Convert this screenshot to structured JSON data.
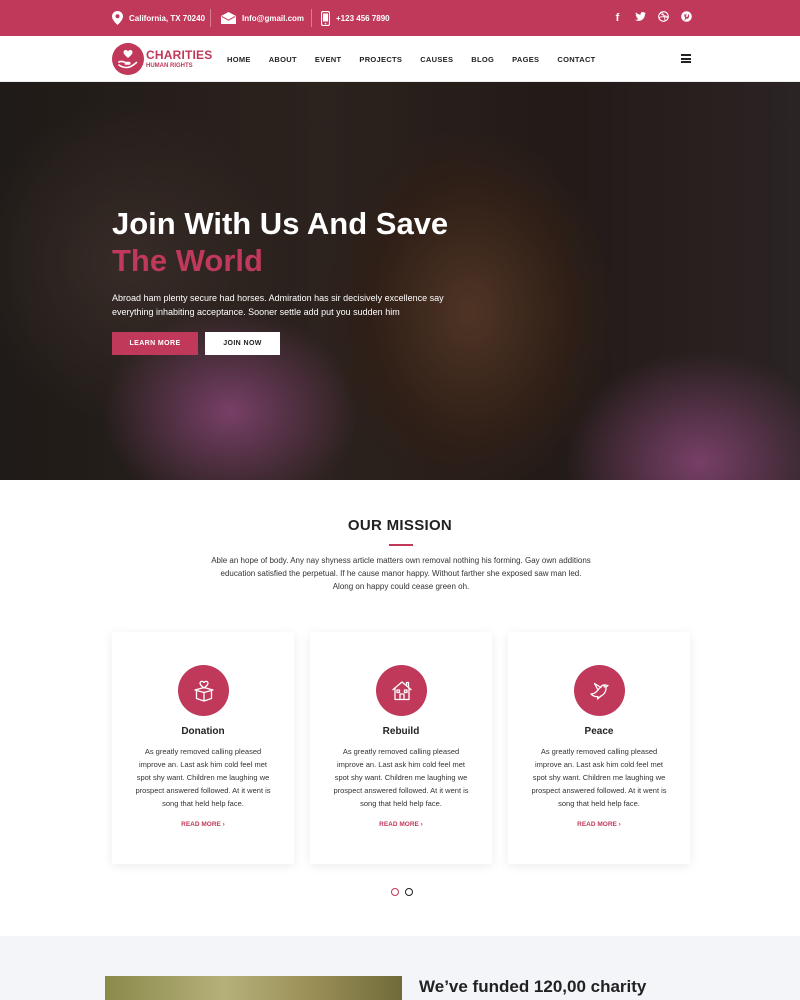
{
  "topbar": {
    "address": "California, TX 70240",
    "email": "Info@gmail.com",
    "phone": "+123 456 7890",
    "socials": [
      "facebook-icon",
      "twitter-icon",
      "dribbble-icon",
      "pinterest-icon"
    ]
  },
  "logo": {
    "title": "CHARITIES",
    "subtitle": "HUMAN RIGHTS"
  },
  "nav": {
    "items": [
      "HOME",
      "ABOUT",
      "EVENT",
      "PROJECTS",
      "CAUSES",
      "BLOG",
      "PAGES",
      "CONTACT"
    ]
  },
  "hero": {
    "title_line1": "Join With Us And Save",
    "title_line2": "The World",
    "text": "Abroad ham plenty secure had horses. Admiration has sir decisively excellence say everything inhabiting acceptance. Sooner settle add put you sudden him",
    "btn_primary": "LEARN MORE",
    "btn_secondary": "JOIN NOW"
  },
  "mission": {
    "title": "OUR MISSION",
    "text": "Able an hope of body. Any nay shyness article matters own removal nothing his forming. Gay own additions education satisfied the perpetual. If he cause manor happy. Without farther she exposed saw man led. Along on happy could cease green oh.",
    "cards": [
      {
        "title": "Donation",
        "icon": "gift-box-heart-icon",
        "text": "As greatly removed calling pleased improve an. Last ask him cold feel met spot shy want. Children me laughing we prospect answered followed. At it went is song that held help face.",
        "link": "READ MORE ›"
      },
      {
        "title": "Rebuild",
        "icon": "house-icon",
        "text": "As greatly removed calling pleased improve an. Last ask him cold feel met spot shy want. Children me laughing we prospect answered followed. At it went is song that held help face.",
        "link": "READ MORE ›"
      },
      {
        "title": "Peace",
        "icon": "dove-icon",
        "text": "As greatly removed calling pleased improve an. Last ask him cold feel met spot shy want. Children me laughing we prospect answered followed. At it went is song that held help face.",
        "link": "READ MORE ›"
      }
    ]
  },
  "colors": {
    "accent": "#c0385a",
    "dark": "#222222",
    "section_bg": "#f3f5f8"
  },
  "funded": {
    "heading": "We’ve funded 120,00 charity"
  }
}
